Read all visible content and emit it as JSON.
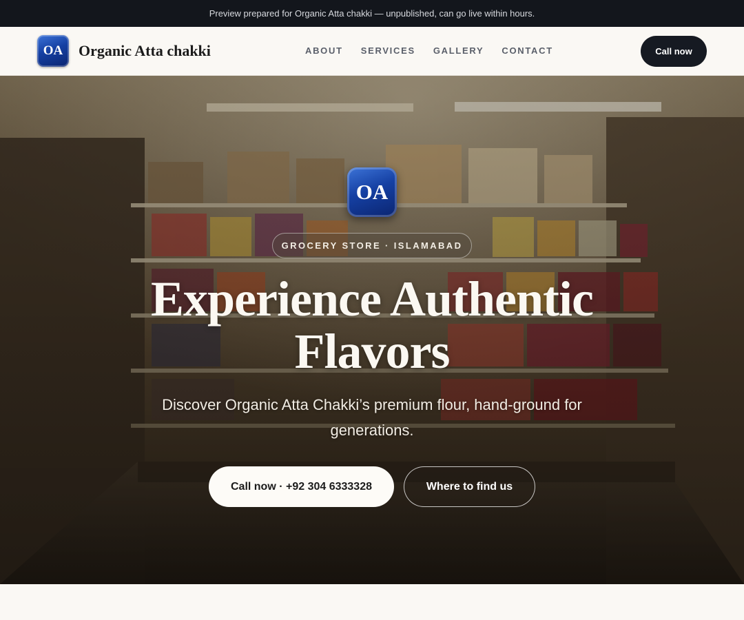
{
  "preview_bar": {
    "text": "Preview prepared for Organic Atta chakki — unpublished, can go live within hours."
  },
  "header": {
    "logo_initials": "OA",
    "brand_name": "Organic Atta chakki",
    "nav": [
      {
        "label": "ABOUT"
      },
      {
        "label": "SERVICES"
      },
      {
        "label": "GALLERY"
      },
      {
        "label": "CONTACT"
      }
    ],
    "call_label": "Call now"
  },
  "hero": {
    "badge_initials": "OA",
    "eyebrow": "GROCERY STORE · ISLAMABAD",
    "title": "Experience Authentic Flavors",
    "subtitle": "Discover Organic Atta Chakki’s premium flour, hand-ground for generations.",
    "primary_cta": "Call now · +92 304 6333328",
    "secondary_cta": "Where to find us"
  },
  "colors": {
    "accent_dark": "#161a22",
    "logo_blue": "#1540a3",
    "background": "#faf8f4"
  }
}
